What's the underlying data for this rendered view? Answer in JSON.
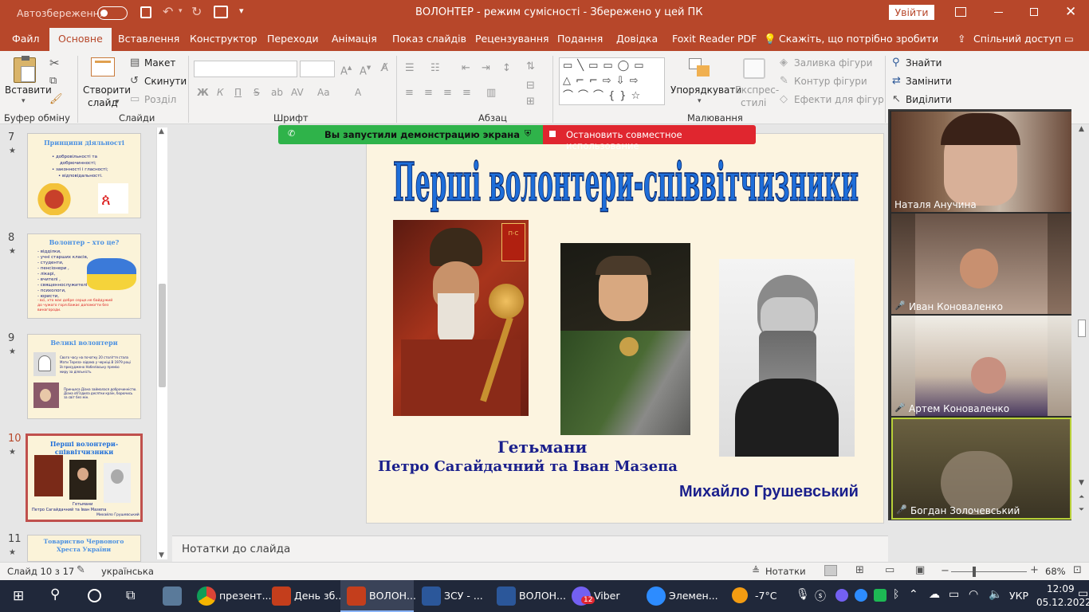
{
  "titlebar": {
    "autosave_label": "Автозбереження",
    "autosave_state": "Вимк",
    "doc_title": "ВОЛОНТЕР  -  режим сумісності  -  Збережено у цей ПК",
    "signin_button": "Увійти"
  },
  "tabs": [
    "Файл",
    "Основне",
    "Вставлення",
    "Конструктор",
    "Переходи",
    "Анімація",
    "Показ слайдів",
    "Рецензування",
    "Подання",
    "Довідка",
    "Foxit Reader PDF"
  ],
  "tell_me": "Скажіть, що потрібно зробити",
  "share_label": "Спільний доступ",
  "ribbon": {
    "paste": "Вставити",
    "new_slide_line1": "Створити",
    "new_slide_line2": "слайд",
    "layout": "Макет",
    "reset": "Скинути",
    "section": "Розділ",
    "bold": "Ж",
    "italic": "К",
    "underline": "П",
    "arrange": "Упорядкувати",
    "quick_styles_line1": "Експрес-",
    "quick_styles_line2": "стилі",
    "shape_fill": "Заливка фігури",
    "shape_outline": "Контур фігури",
    "shape_effects": "Ефекти для фігур",
    "find": "Знайти",
    "replace": "Замінити",
    "select": "Виділити",
    "groups": {
      "clipboard": "Буфер обміну",
      "slides": "Слайди",
      "font": "Шрифт",
      "paragraph": "Абзац",
      "drawing": "Малювання"
    }
  },
  "share_banner": {
    "left_text": "Вы запустили демонстрацию экрана",
    "right_text": "Остановить совместное использование",
    "left_color": "#2fb34a",
    "right_color": "#e0262f"
  },
  "thumbnails": [
    {
      "num": "7",
      "title": "Принципи діяльності",
      "lines": [
        "• добровільності та",
        "добрючинності;",
        "• законності і гласності;",
        "• відповідальності."
      ]
    },
    {
      "num": "8",
      "title": "Волонтер – хто це?",
      "lines": [
        "- відділки,",
        "- учні старших класів,",
        "- студенти,",
        "- пенсіонери ,",
        "- лікарі,",
        "- вчителі ,",
        "- священнослужителі",
        "- психологи,",
        "- юристи,"
      ],
      "red_text": "- всі, хто має добре серце.не байдужий до чужого горя.бажає допомогти без винагороди."
    },
    {
      "num": "9",
      "title": "Великі волонтери",
      "lines": [
        "Свого часу на початку 20 століття стала",
        "Мати Тереза- відома у черніці.В 1979 році",
        "їй присуджено Нобелівську премію",
        "миру за діяльність"
      ],
      "second_text": "Принцеса Діана займалася доброчинністю. Діана об'їздила десятки країн, борючись за світ без мін."
    },
    {
      "num": "10",
      "title": "Перші волонтери-співвітчизники",
      "caption1": "Гетьмани",
      "caption2": "Петро Сагайдачний та Іван Мазепа",
      "caption3": "Михайло Грушевський"
    },
    {
      "num": "11",
      "title": "Товариство Червоного Хреста України"
    }
  ],
  "slide": {
    "title": "Перші волонтери-співвітчизники",
    "caption_line1": "Гетьмани",
    "caption_line2": "Петро Сагайдачний та Іван Мазепа",
    "caption_right": "Михайло Грушевський",
    "emblem_text": "П-С"
  },
  "notes_placeholder": "Нотатки до слайда",
  "video_participants": [
    {
      "name": "Наталя Анучина",
      "muted": false
    },
    {
      "name": "Иван Коноваленко",
      "muted": true
    },
    {
      "name": "Артем Коноваленко",
      "muted": true
    },
    {
      "name": "Богдан Золочевський",
      "muted": true
    }
  ],
  "statusbar": {
    "slide_count": "Слайд 10 з 17",
    "language": "українська",
    "notes_button": "Нотатки",
    "zoom": "68%"
  },
  "taskbar": {
    "apps": [
      "презент...",
      "День зб...",
      "ВОЛОН...",
      "ЗСУ - ...",
      "ВОЛОН...",
      "Viber",
      "Элемен..."
    ],
    "viber_badge": "12",
    "temperature": "-7°C",
    "language": "УКР",
    "time": "12:09",
    "date": "05.12.2022"
  },
  "colors": {
    "ppt_accent": "#b7472a",
    "taskbar_bg": "#20283a",
    "slide_title_blue": "#1e6ed9",
    "caption_navy": "#1a1f8c"
  }
}
